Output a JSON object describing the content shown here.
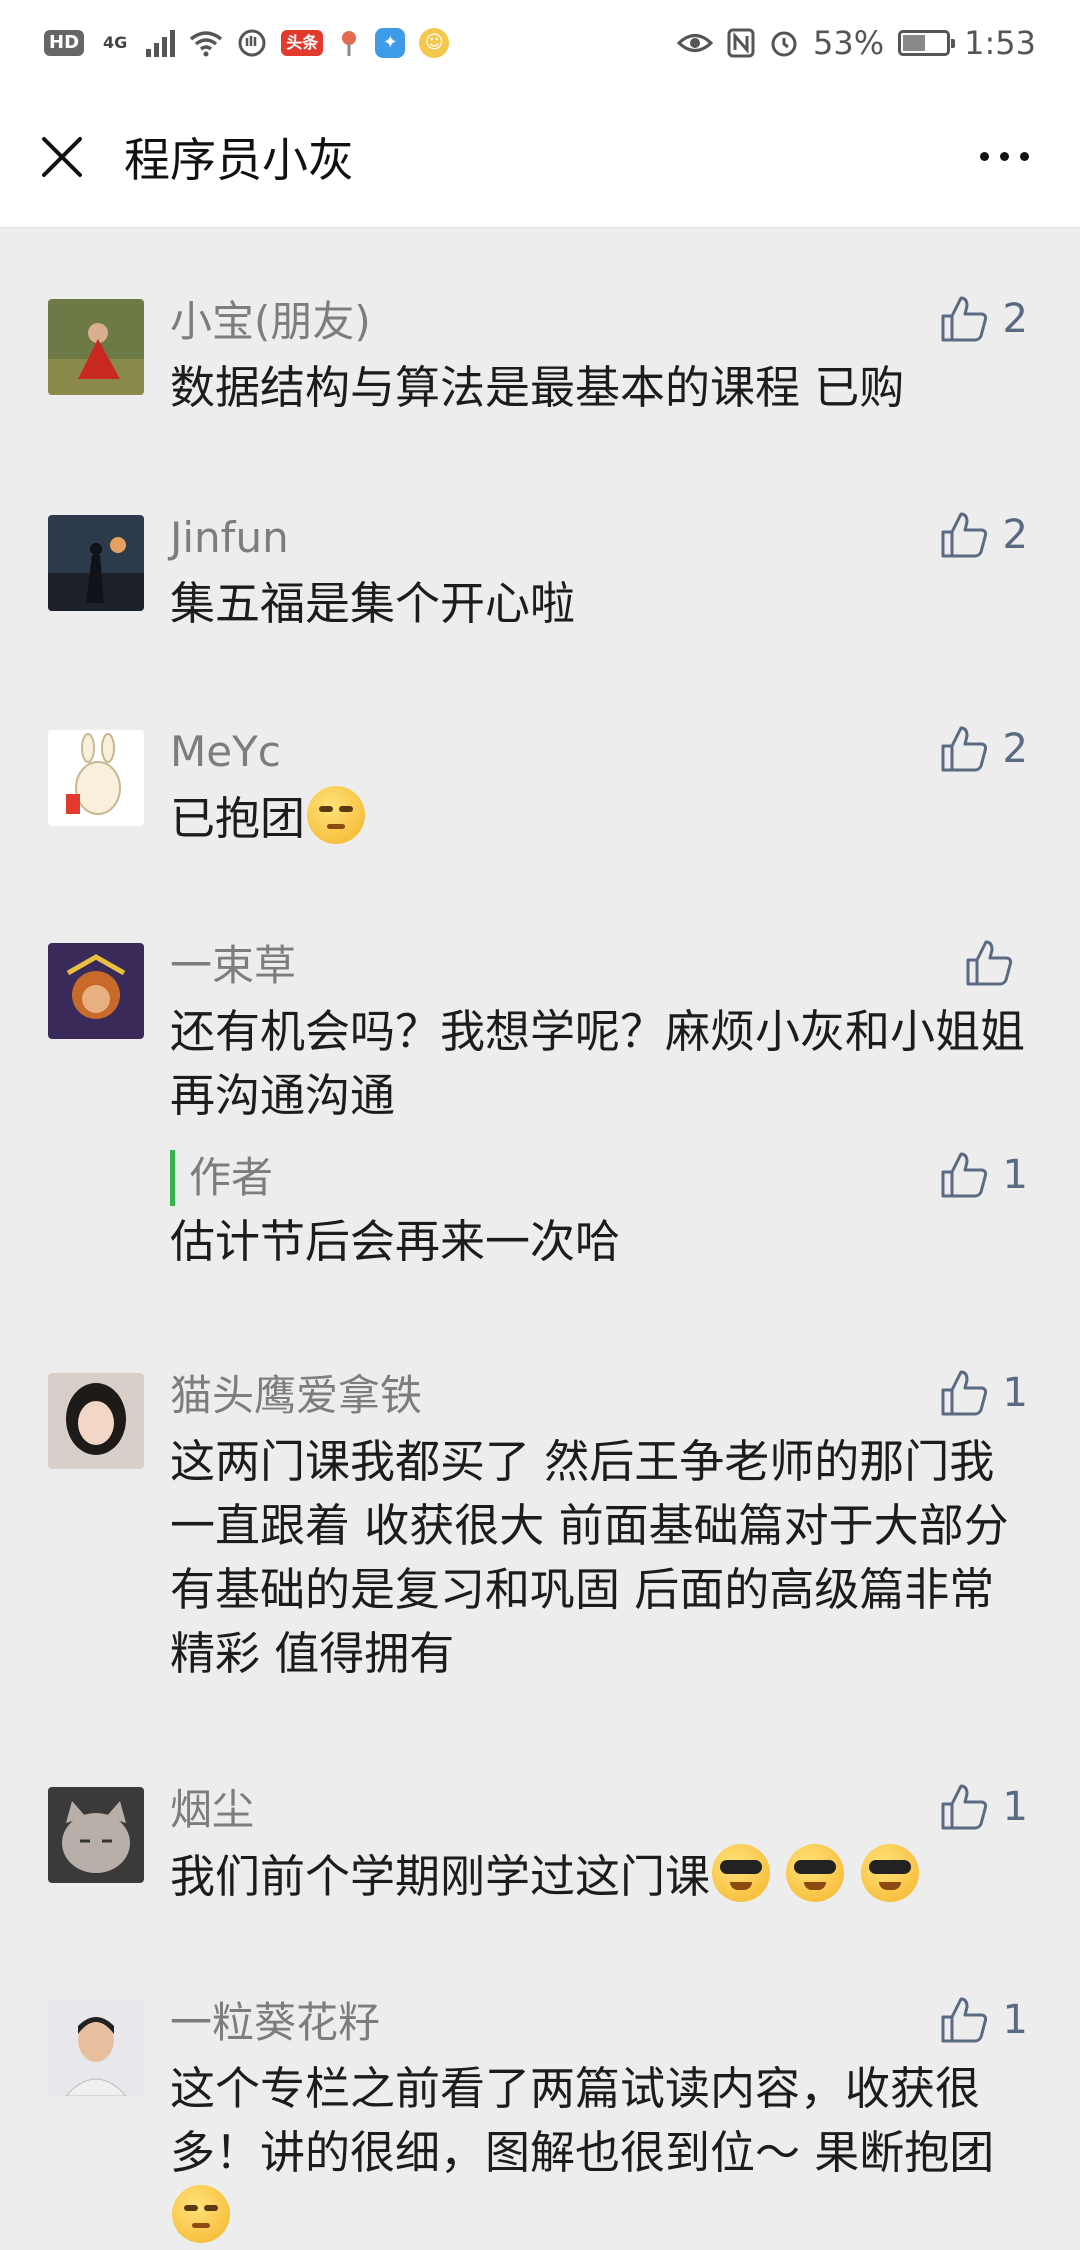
{
  "status_bar": {
    "hd": "HD",
    "network": "4G",
    "app_badge": "头条",
    "battery": "53%",
    "battery_level": 0.53,
    "time": "1:53"
  },
  "header": {
    "title": "程序员小灰"
  },
  "comments": [
    {
      "name": "小宝(朋友)",
      "text": "数据结构与算法是最基本的课程 已购",
      "likes": "2",
      "avatar": "avatar-girl-red-dress"
    },
    {
      "name": "Jinfun",
      "text": "集五福是集个开心啦",
      "likes": "2",
      "avatar": "avatar-warrior-sunset"
    },
    {
      "name": "MeYc",
      "text": "已抱团",
      "likes": "2",
      "avatar": "avatar-cartoon-rabbit",
      "emoji": "smirk"
    },
    {
      "name": "一束草",
      "text": "还有机会吗？我想学呢？麻烦小灰和小姐姐再沟通沟通",
      "likes": "",
      "avatar": "avatar-monkey-king",
      "reply": {
        "name": "作者",
        "text": "估计节后会再来一次哈",
        "likes": "1"
      }
    },
    {
      "name": "猫头鹰爱拿铁",
      "text": "这两门课我都买了 然后王争老师的那门我一直跟着 收获很大 前面基础篇对于大部分有基础的是复习和巩固 后面的高级篇非常精彩 值得拥有",
      "likes": "1",
      "avatar": "avatar-girl-portrait"
    },
    {
      "name": "烟尘",
      "text": "我们前个学期刚学过这门课",
      "likes": "1",
      "avatar": "avatar-cat",
      "emoji": "cool-x3"
    },
    {
      "name": "一粒葵花籽",
      "text": "这个专栏之前看了两篇试读内容，收获很多！讲的很细，图解也很到位～ 果断抱团",
      "likes": "1",
      "avatar": "avatar-man-portrait",
      "emoji": "smirk"
    }
  ]
}
